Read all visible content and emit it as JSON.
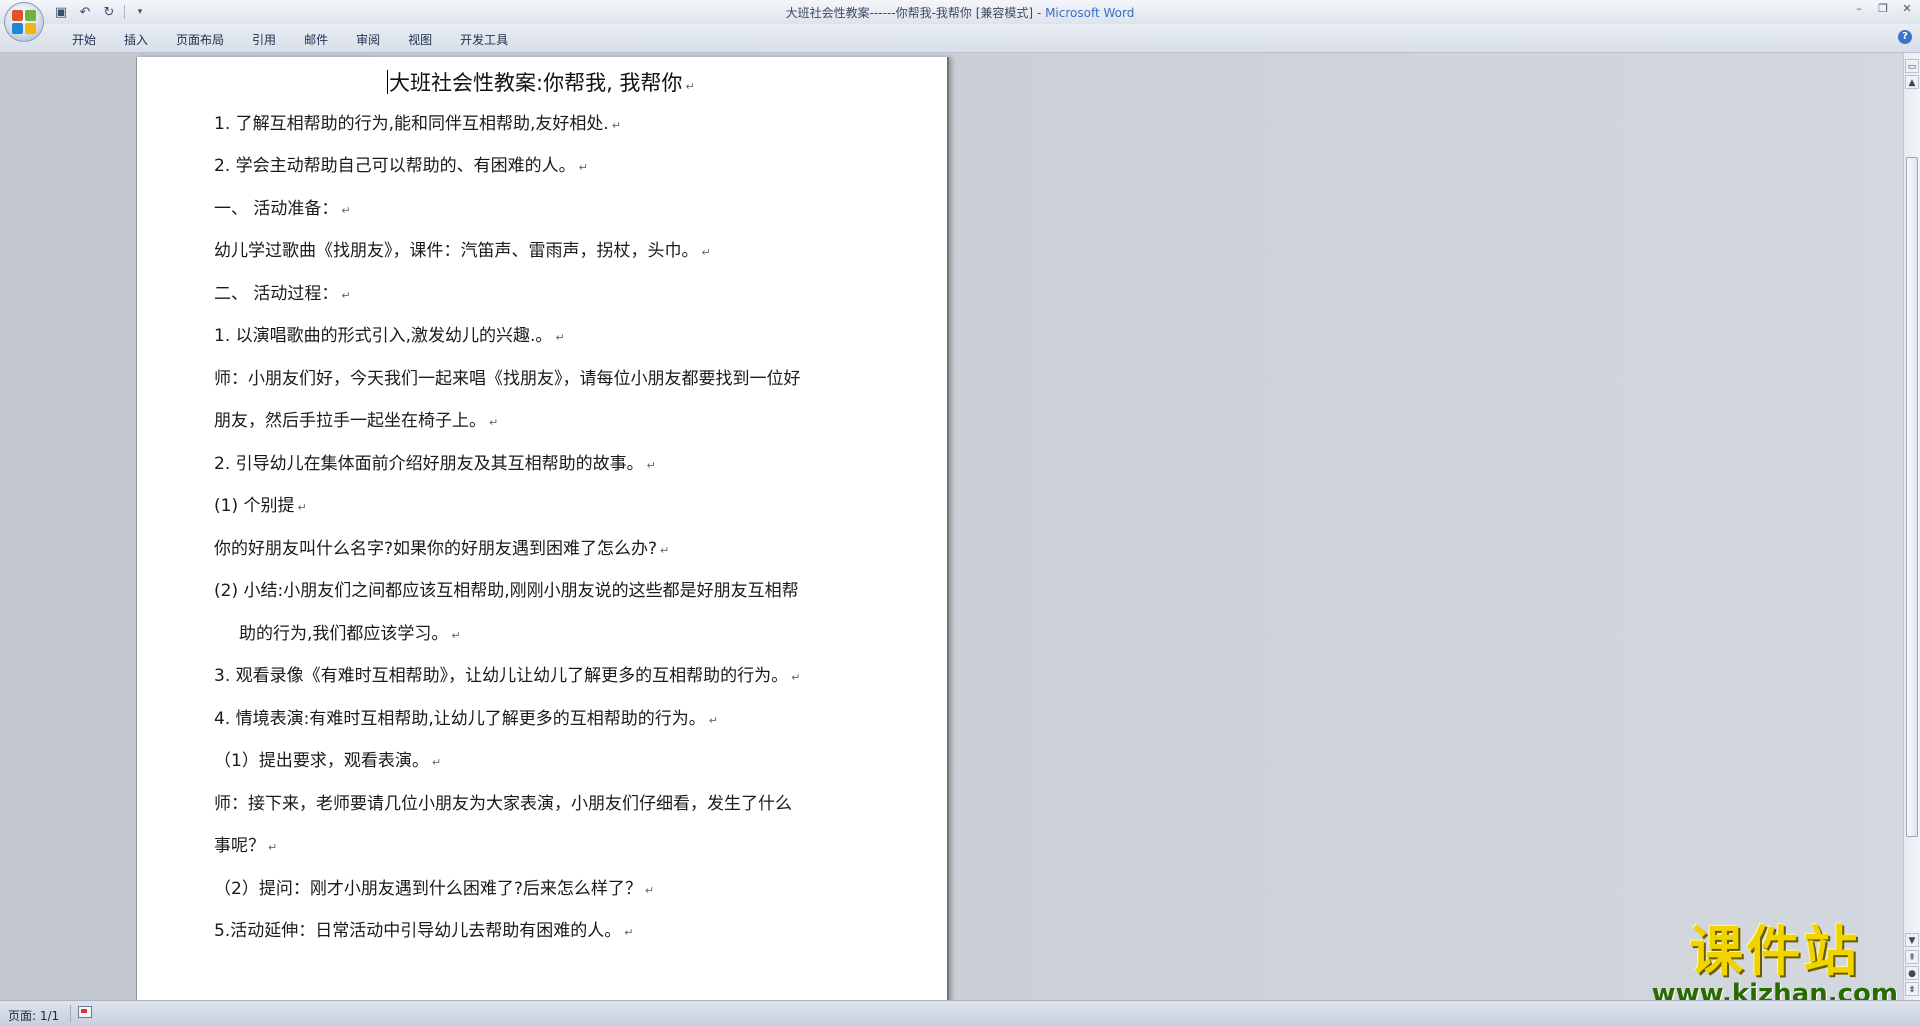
{
  "window": {
    "title": "大班社会性教案------你帮我-我帮你 [兼容模式] - ",
    "app_name": "Microsoft Word"
  },
  "qat": {
    "save_icon": "floppy-save-icon",
    "undo_icon": "undo-icon",
    "redo_icon": "redo-icon",
    "customize_icon": "dropdown-arrow-icon"
  },
  "ribbon": {
    "tabs": [
      "开始",
      "插入",
      "页面布局",
      "引用",
      "邮件",
      "审阅",
      "视图",
      "开发工具"
    ],
    "help_label": "?"
  },
  "document": {
    "title": "大班社会性教案:你帮我, 我帮你",
    "paragraphs": [
      "1.  了解互相帮助的行为,能和同伴互相帮助,友好相处.",
      "2.  学会主动帮助自己可以帮助的、有困难的人。",
      "一、  活动准备：",
      "幼儿学过歌曲《找朋友》，课件：汽笛声、雷雨声，拐杖，头巾。",
      "二、  活动过程：",
      "1.  以演唱歌曲的形式引入,激发幼儿的兴趣.。",
      "师：小朋友们好，今天我们一起来唱《找朋友》，请每位小朋友都要找到一位好",
      "朋友，然后手拉手一起坐在椅子上。",
      "2.  引导幼儿在集体面前介绍好朋友及其互相帮助的故事。",
      "(1) 个别提",
      "你的好朋友叫什么名字?如果你的好朋友遇到困难了怎么办?",
      "(2) 小结:小朋友们之间都应该互相帮助,刚刚小朋友说的这些都是好朋友互相帮",
      "助的行为,我们都应该学习。",
      "3.  观看录像《有难时互相帮助》，让幼儿让幼儿了解更多的互相帮助的行为。",
      "4.  情境表演:有难时互相帮助,让幼儿了解更多的互相帮助的行为。",
      "（1）提出要求，观看表演。",
      "师：接下来，老师要请几位小朋友为大家表演，小朋友们仔细看，发生了什么",
      "事呢？",
      "（2）提问：刚才小朋友遇到什么困难了?后来怎么样了？",
      "5.活动延伸：日常活动中引导幼儿去帮助有困难的人。"
    ],
    "paragraph_mark": "↵"
  },
  "status": {
    "page": "页面: 1/1"
  },
  "watermark": {
    "main": "课件站",
    "url": "www.kjzhan.com"
  }
}
